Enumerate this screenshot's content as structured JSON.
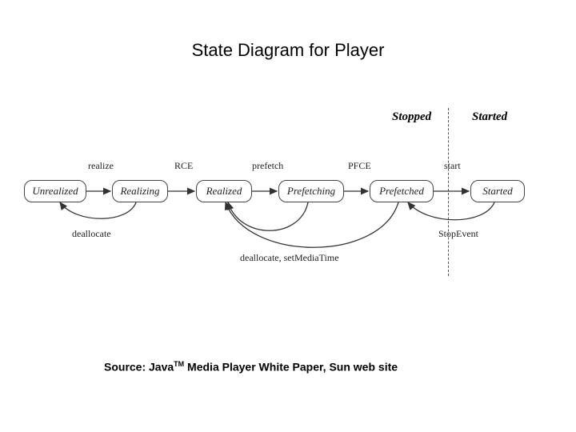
{
  "title": "State Diagram for Player",
  "regions": {
    "stopped": "Stopped",
    "started": "Started"
  },
  "states": {
    "unrealized": "Unrealized",
    "realizing": "Realizing",
    "realized": "Realized",
    "prefetching": "Prefetching",
    "prefetched": "Prefetched",
    "started": "Started"
  },
  "edges": {
    "realize": "realize",
    "rce": "RCE",
    "prefetch": "prefetch",
    "pfce": "PFCE",
    "start": "start",
    "dealloc1": "deallocate",
    "dealloc2": "deallocate, setMediaTime",
    "stopevent": "StopEvent"
  },
  "source": {
    "prefix": "Source: Java",
    "tm": "TM",
    "suffix": " Media Player White Paper, Sun web site"
  }
}
